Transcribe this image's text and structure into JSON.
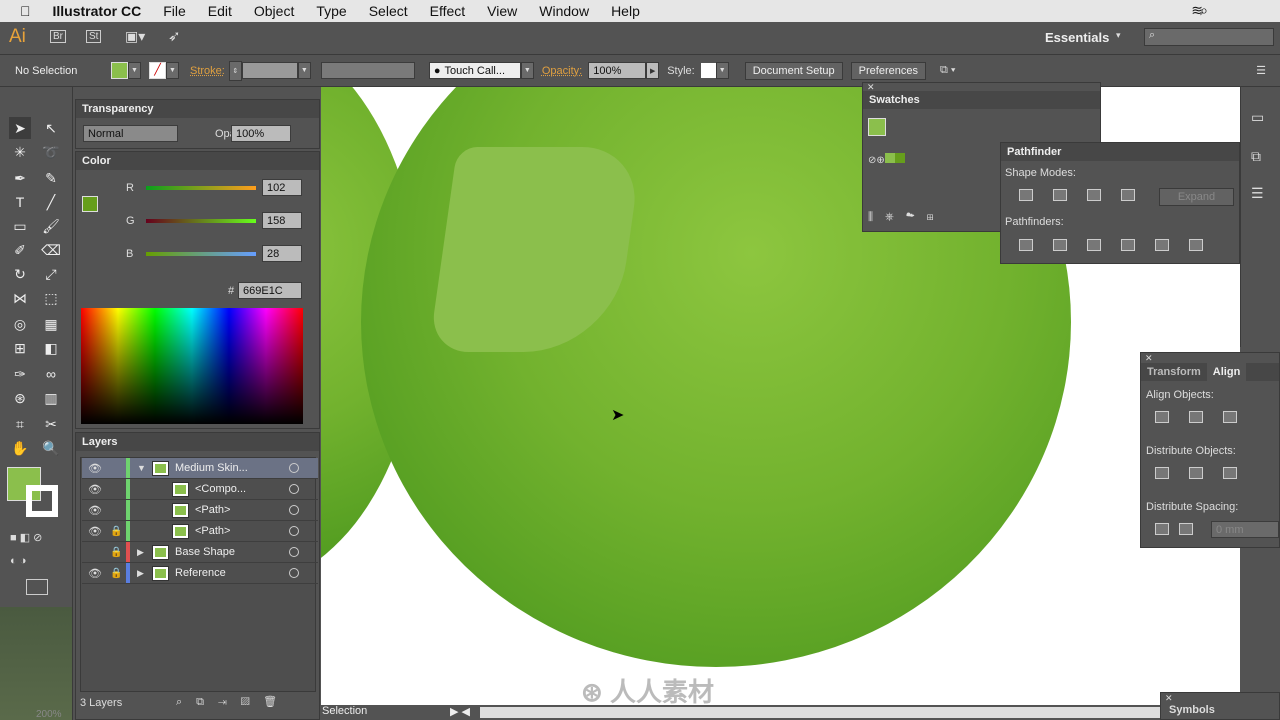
{
  "menubar": {
    "app": "Illustrator CC",
    "items": [
      "File",
      "Edit",
      "Object",
      "Type",
      "Select",
      "Effect",
      "View",
      "Window",
      "Help"
    ]
  },
  "appbar": {
    "logo": "Ai",
    "bridge": "Br",
    "stock": "St",
    "workspace": "Essentials",
    "search_placeholder": ""
  },
  "control": {
    "selection": "No Selection",
    "stroke_label": "Stroke:",
    "brush": "Touch Call...",
    "opacity_label": "Opacity:",
    "opacity": "100%",
    "style_label": "Style:",
    "document_setup": "Document Setup",
    "preferences": "Preferences",
    "fill_color": "#669E1C"
  },
  "transparency": {
    "title": "Transparency",
    "blend": "Normal",
    "opacity_label": "Opacity:",
    "opacity": "100%"
  },
  "color": {
    "title": "Color",
    "r_label": "R",
    "g_label": "G",
    "b_label": "B",
    "r": "102",
    "g": "158",
    "b": "28",
    "hex_label": "#",
    "hex": "669E1C",
    "r_frac": 0.4,
    "g_frac": 0.62,
    "b_frac": 0.11
  },
  "layers": {
    "title": "Layers",
    "rows": [
      {
        "name": "Medium Skin...",
        "visible": true,
        "locked": false,
        "color": "#6fd36f",
        "expanded": true,
        "indent": 0
      },
      {
        "name": "<Compo...",
        "visible": true,
        "locked": false,
        "color": "#6fd36f",
        "indent": 1
      },
      {
        "name": "<Path>",
        "visible": true,
        "locked": false,
        "color": "#6fd36f",
        "indent": 1
      },
      {
        "name": "<Path>",
        "visible": true,
        "locked": true,
        "color": "#6fd36f",
        "indent": 1
      },
      {
        "name": "Base Shape",
        "visible": false,
        "locked": true,
        "color": "#e05050",
        "expanded": false,
        "indent": 0
      },
      {
        "name": "Reference",
        "visible": true,
        "locked": true,
        "color": "#5a7ee0",
        "expanded": false,
        "indent": 0
      }
    ],
    "count": "3 Layers"
  },
  "swatches": {
    "title": "Swatches"
  },
  "pathfinder": {
    "title": "Pathfinder",
    "shape_modes": "Shape Modes:",
    "expand": "Expand",
    "pathfinders": "Pathfinders:"
  },
  "align": {
    "tab_transform": "Transform",
    "tab_align": "Align",
    "align_objects": "Align Objects:",
    "distribute_objects": "Distribute Objects:",
    "distribute_spacing": "Distribute Spacing:",
    "spacing_value": "0 mm"
  },
  "status": {
    "zoom": "200%",
    "tool": "Selection"
  },
  "symbols": {
    "title": "Symbols"
  },
  "watermark": "人人素材"
}
